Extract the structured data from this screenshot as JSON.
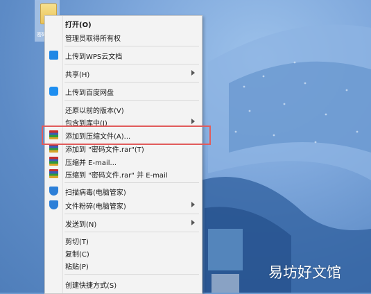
{
  "desktop": {
    "folder_label": "密码"
  },
  "menu": {
    "items": [
      {
        "label": "打开(O)",
        "bold": true,
        "icon": ""
      },
      {
        "label": "管理员取得所有权",
        "icon": ""
      },
      {
        "label": "上传到WPS云文档",
        "icon": "wps-cloud-icon"
      },
      {
        "label": "共享(H)",
        "icon": "",
        "submenu": true
      },
      {
        "label": "上传到百度网盘",
        "icon": "baidu-netdisk-icon"
      },
      {
        "label": "还原以前的版本(V)",
        "icon": ""
      },
      {
        "label": "包含到库中(I)",
        "icon": "",
        "submenu": true
      },
      {
        "label": "添加到压缩文件(A)...",
        "icon": "winrar-icon"
      },
      {
        "label": "添加到 \"密码文件.rar\"(T)",
        "icon": "winrar-icon"
      },
      {
        "label": "压缩并 E-mail...",
        "icon": "winrar-icon"
      },
      {
        "label": "压缩到 \"密码文件.rar\" 并 E-mail",
        "icon": "winrar-icon"
      },
      {
        "label": "扫描病毒(电脑管家)",
        "icon": "pc-manager-shield-icon"
      },
      {
        "label": "文件粉碎(电脑管家)",
        "icon": "pc-manager-shield-icon",
        "submenu": true
      },
      {
        "label": "发送到(N)",
        "icon": "",
        "submenu": true
      },
      {
        "label": "剪切(T)",
        "icon": ""
      },
      {
        "label": "复制(C)",
        "icon": ""
      },
      {
        "label": "粘贴(P)",
        "icon": ""
      },
      {
        "label": "创建快捷方式(S)",
        "icon": ""
      }
    ],
    "highlighted_item": "添加到压缩文件(A)..."
  },
  "watermark": "易坊好文馆",
  "colors": {
    "highlight_border": "#e15b5b",
    "menu_bg": "#f3f3f3",
    "desktop_bg": "#6d9bd0"
  }
}
